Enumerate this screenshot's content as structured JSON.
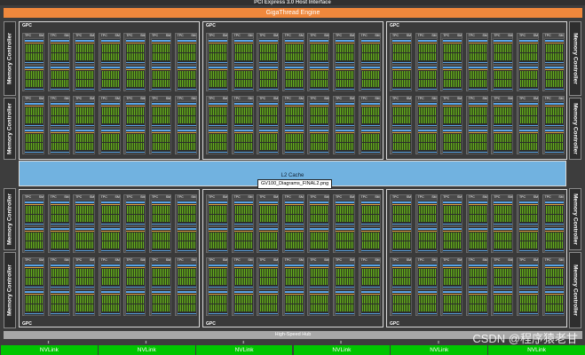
{
  "header": {
    "pcie_label": "PCI Express 3.0 Host Interface",
    "giga_label": "GigaThread Engine"
  },
  "memory_controller_label": "Memory Controller",
  "gpc_label": "GPC",
  "tpc_label": "TPC",
  "sm_label": "SM",
  "l2": {
    "label": "L2 Cache",
    "filename": "GV100_Diagrams_FINAL2.png"
  },
  "hub_label": "High-Speed Hub",
  "nvlink_label": "NVLink",
  "nvlink_count": 6,
  "gpc_count": 6,
  "tpc_per_gpc": 7,
  "sm_per_tpc": 2,
  "watermark": "CSDN @程序猿老甘",
  "colors": {
    "background": "#3d3d3d",
    "giga_engine": "#f0883c",
    "l2_cache": "#71b2e0",
    "cuda_cores": "#66b21f",
    "nvlink": "#00c600",
    "hub": "#a8a8a8"
  }
}
